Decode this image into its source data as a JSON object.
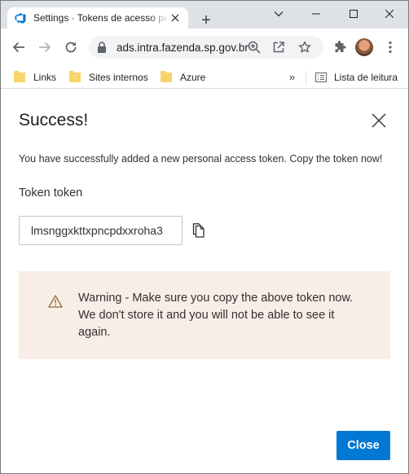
{
  "browser": {
    "tab": {
      "title": "Settings · Tokens de acesso pessoal",
      "favicon": "azure-devops-icon"
    },
    "new_tab_label": "+",
    "window_controls": [
      "chevron-down-icon",
      "minimize-icon",
      "maximize-icon",
      "close-icon"
    ],
    "address_bar": {
      "url": "ads.intra.fazenda.sp.gov.br"
    },
    "toolbar_icons": [
      "back-icon",
      "forward-icon",
      "reload-icon",
      "zoom-icon",
      "share-icon",
      "star-icon",
      "extensions-icon",
      "avatar",
      "menu-icon"
    ],
    "bookmarks": [
      {
        "label": "Links"
      },
      {
        "label": "Sites internos"
      },
      {
        "label": "Azure"
      }
    ],
    "bookmarks_more": "»",
    "reading_list_label": "Lista de leitura"
  },
  "dialog": {
    "title": "Success!",
    "message": "You have successfully added a new personal access token. Copy the token now!",
    "token_name": "Token token",
    "token_value": "lmsnggxkttxpncpdxxroha3",
    "warning_text": "Warning - Make sure you copy the above token now. We don't store it and you will not be able to see it again.",
    "close_button": "Close"
  },
  "colors": {
    "primary_button": "#0078d4",
    "warning_background": "#f9ede7",
    "tabstrip": "#dee1e6",
    "bookmark_folder": "#f9d36b"
  }
}
